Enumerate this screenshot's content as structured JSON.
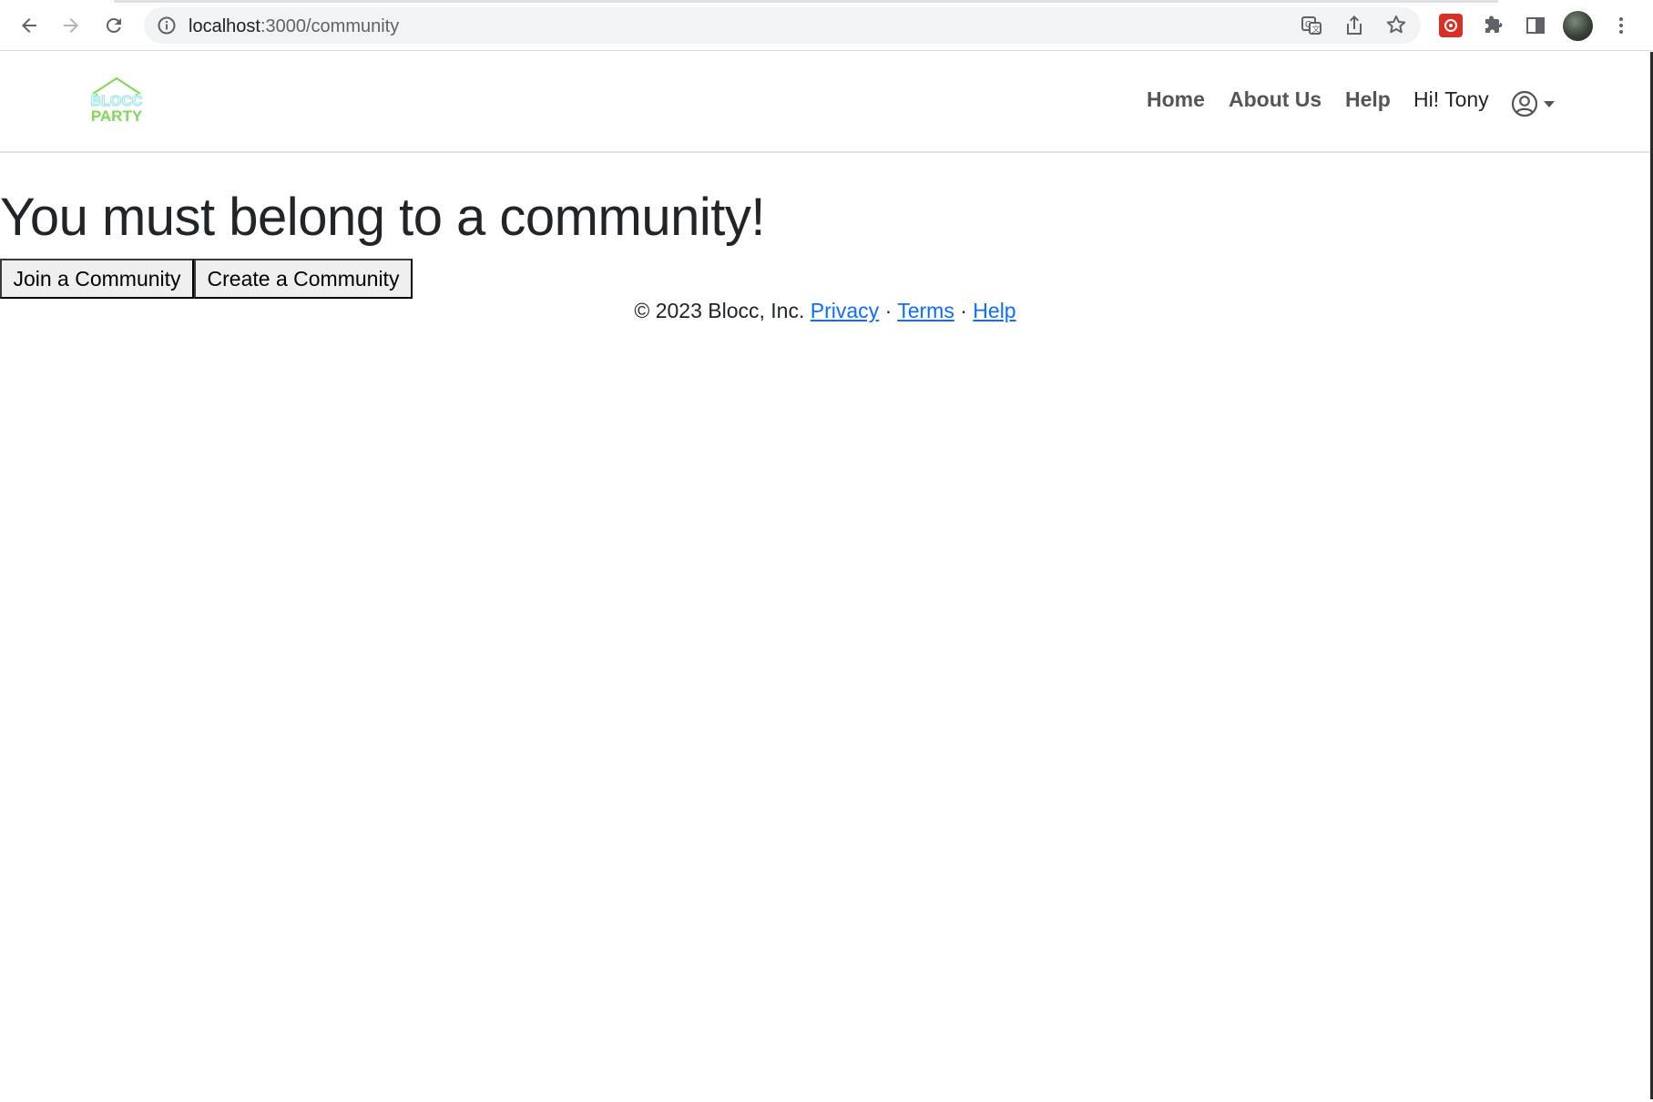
{
  "browser": {
    "url_host": "localhost",
    "url_path": ":3000/community"
  },
  "navbar": {
    "logo_top": "BLOCC",
    "logo_bottom": "PARTY",
    "links": [
      "Home",
      "About Us",
      "Help"
    ],
    "greeting": "Hi! Tony"
  },
  "main": {
    "heading": "You must belong to a community!",
    "join_button": "Join a Community",
    "create_button": "Create a Community"
  },
  "footer": {
    "copyright": "© 2023 Blocc, Inc.",
    "separator": "·",
    "privacy": "Privacy",
    "terms": "Terms",
    "help": "Help"
  },
  "colors": {
    "link": "#0d6efd",
    "nav_text": "#555555",
    "logo_green": "#7ed957",
    "logo_teal": "#9fe6e6",
    "extension_red": "#d93025"
  },
  "icons": {
    "back": "arrow-left-icon",
    "forward": "arrow-right-icon",
    "reload": "reload-icon",
    "site_info": "info-icon",
    "translate": "translate-icon",
    "share": "share-icon",
    "bookmark": "star-icon",
    "extension": "extension-icon",
    "extensions": "puzzle-icon",
    "side_panel": "side-panel-icon",
    "profile": "profile-avatar",
    "menu": "kebab-menu-icon",
    "user": "user-circle-icon"
  }
}
